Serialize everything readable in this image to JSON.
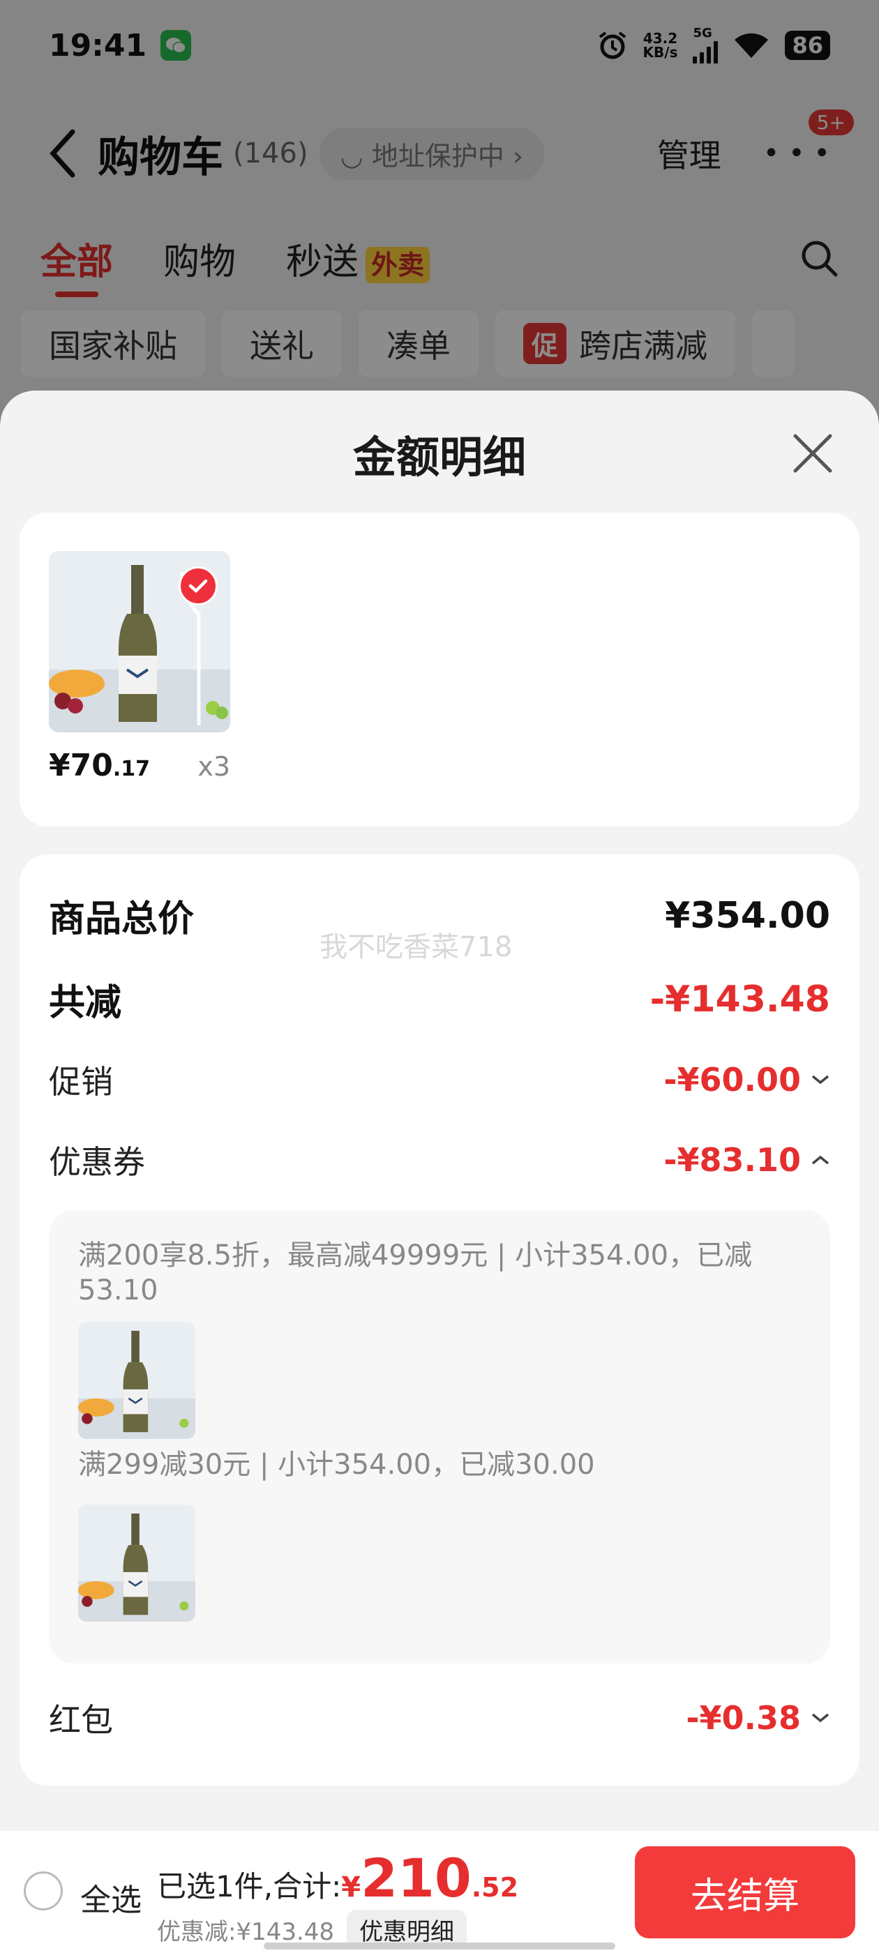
{
  "status_bar": {
    "time": "19:41",
    "net_speed": "43.2",
    "net_unit": "KB/s",
    "network": "5G",
    "battery": "86"
  },
  "nav": {
    "title": "购物车",
    "count": "(146)",
    "address_protect": "地址保护中",
    "manage": "管理",
    "badge": "5+"
  },
  "tabs": [
    {
      "label": "全部"
    },
    {
      "label": "购物"
    },
    {
      "label": "秒送",
      "tag": "外卖"
    }
  ],
  "chips": [
    {
      "label": "国家补贴"
    },
    {
      "label": "送礼"
    },
    {
      "label": "凑单"
    },
    {
      "label": "跨店满减",
      "tag": "促"
    }
  ],
  "sheet": {
    "title": "金额明细",
    "product": {
      "price_int": "¥70",
      "price_dec": ".17",
      "qty": "x3"
    },
    "watermark": "我不吃香菜718",
    "rows": {
      "total_label": "商品总价",
      "total_value": "¥354.00",
      "discount_label": "共减",
      "discount_value": "-¥143.48",
      "promo_label": "促销",
      "promo_value": "-¥60.00",
      "coupon_label": "优惠券",
      "coupon_value": "-¥83.10",
      "redpacket_label": "红包",
      "redpacket_value": "-¥0.38"
    },
    "coupons": [
      {
        "text": "满200享8.5折，最高减49999元 | 小计354.00，已减53.10"
      },
      {
        "text": "满299减30元 | 小计354.00，已减30.00"
      }
    ]
  },
  "bottom_bar": {
    "select_all": "全选",
    "selected_prefix": "已选1件,合计:",
    "total_yen": "¥",
    "total_int": "210",
    "total_dec": ".52",
    "saved": "优惠减:¥143.48",
    "detail_btn": "优惠明细",
    "checkout": "去结算"
  },
  "colors": {
    "accent_red": "#e62e2e",
    "checkout_red": "#f33b3b",
    "promo_yellow": "#ffd43b"
  }
}
